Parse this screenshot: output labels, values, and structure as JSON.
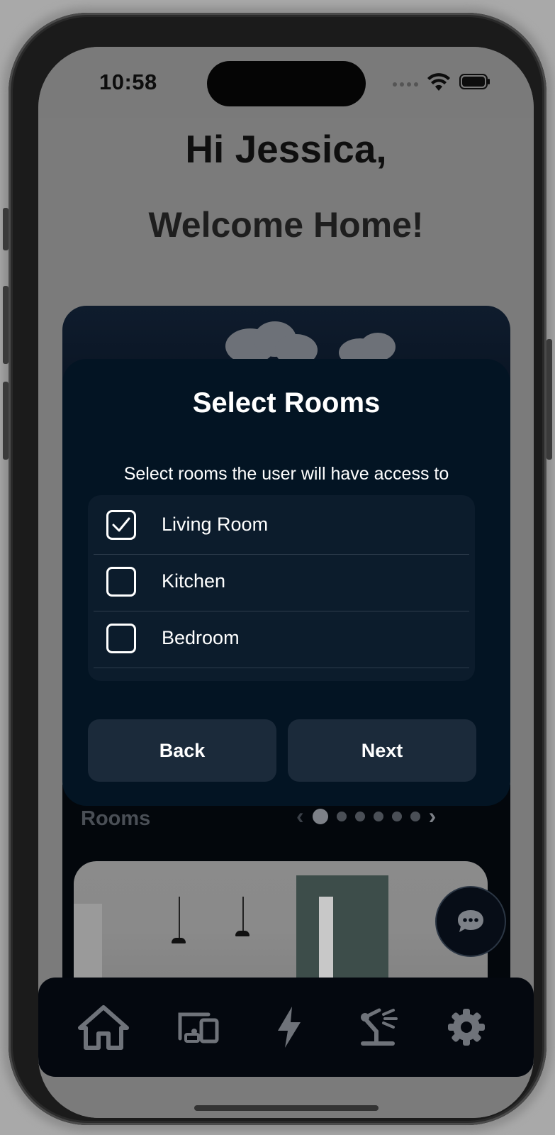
{
  "status_bar": {
    "time": "10:58",
    "icons": [
      "signal-icon",
      "wifi-icon",
      "battery-icon"
    ]
  },
  "header": {
    "greeting": "Hi Jessica,",
    "welcome": "Welcome Home!"
  },
  "modal": {
    "title": "Select Rooms",
    "subtitle": "Select rooms the user will have access to",
    "rooms": [
      {
        "label": "Living Room",
        "checked": true
      },
      {
        "label": "Kitchen",
        "checked": false
      },
      {
        "label": "Bedroom",
        "checked": false
      }
    ],
    "back_label": "Back",
    "next_label": "Next"
  },
  "rooms_section": {
    "label": "Rooms",
    "page_count": 6,
    "active_page": 1
  },
  "tab_bar": {
    "items": [
      "home-icon",
      "devices-icon",
      "energy-icon",
      "automation-icon",
      "settings-icon"
    ]
  },
  "colors": {
    "modal_bg": "#031423",
    "list_bg": "#0c1c2c",
    "button_bg": "#1b2a3a",
    "overlay": "#7b7b7b"
  }
}
